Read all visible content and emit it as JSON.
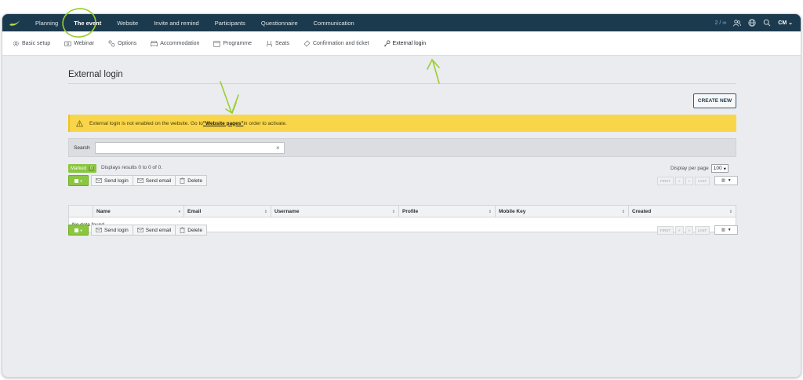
{
  "topnav": {
    "items": [
      {
        "label": "Planning"
      },
      {
        "label": "The event"
      },
      {
        "label": "Website"
      },
      {
        "label": "Invite and remind"
      },
      {
        "label": "Participants"
      },
      {
        "label": "Questionnaire"
      },
      {
        "label": "Communication"
      }
    ],
    "active_index": 1,
    "counter": "2 / ∞",
    "user": "CM",
    "icons": [
      "logo-icon",
      "people-icon",
      "globe-icon",
      "search-icon",
      "chevron-down-icon"
    ]
  },
  "subnav": {
    "items": [
      {
        "label": "Basic setup",
        "icon": "gear-icon"
      },
      {
        "label": "Webinar",
        "icon": "video-icon"
      },
      {
        "label": "Options",
        "icon": "options-icon"
      },
      {
        "label": "Accommodation",
        "icon": "bed-icon"
      },
      {
        "label": "Programme",
        "icon": "calendar-icon"
      },
      {
        "label": "Seats",
        "icon": "seat-icon"
      },
      {
        "label": "Confirmation and ticket",
        "icon": "ticket-icon"
      },
      {
        "label": "External login",
        "icon": "key-icon"
      }
    ],
    "active_index": 7
  },
  "page": {
    "title": "External login",
    "create_button": "CREATE NEW"
  },
  "warning": {
    "text_before": "External login is not enabled on the website. Go to ",
    "link": "\"Website pages\"",
    "text_after": " in order to activate."
  },
  "search": {
    "label": "Search",
    "value": "",
    "clear": "×"
  },
  "listing": {
    "marked_label": "Marked",
    "marked_count": "0",
    "results_text": "Displays results 0 to 0 of 0.",
    "per_page_label": "Display per page",
    "per_page_value": "100"
  },
  "toolbar": {
    "send_login": "Send login",
    "send_email": "Send email",
    "delete": "Delete"
  },
  "pager": {
    "first": "FIRST",
    "prev": "«",
    "next": "»",
    "last": "LAST"
  },
  "table": {
    "columns": [
      "Name",
      "Email",
      "Username",
      "Profile",
      "Mobile Key",
      "Created"
    ],
    "empty_text": "No data found"
  },
  "colors": {
    "nav_bg": "#1c3a4e",
    "accent_green": "#8ac640",
    "warning_bg": "#f9d54a",
    "page_bg": "#ebecef"
  }
}
